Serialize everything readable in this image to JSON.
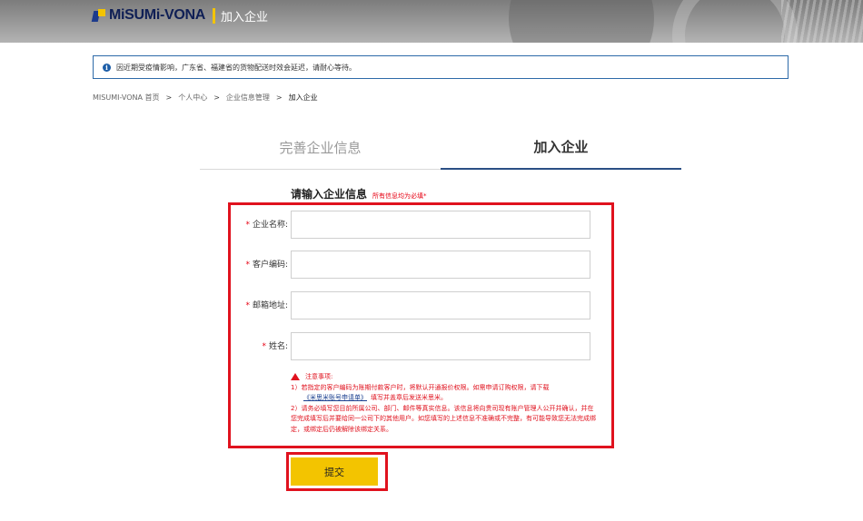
{
  "header": {
    "logo_text": "MiSUMi-VONA",
    "subtitle": "加入企业"
  },
  "notice": {
    "text": "因近期受疫情影响，广东省、福建省的货物配送时效会延迟，请耐心等待。"
  },
  "breadcrumb": {
    "items": [
      "MISUMI-VONA 首页",
      "个人中心",
      "企业信息管理",
      "加入企业"
    ],
    "separator": ">"
  },
  "tabs": [
    {
      "label": "完善企业信息",
      "active": false
    },
    {
      "label": "加入企业",
      "active": true
    }
  ],
  "form": {
    "title": "请输入企业信息",
    "required_hint": "所有信息均为必填*",
    "fields": [
      {
        "label": "企业名称:",
        "value": ""
      },
      {
        "label": "客户编码:",
        "value": ""
      },
      {
        "label": "邮箱地址:",
        "value": ""
      },
      {
        "label": "姓名:",
        "value": ""
      }
    ],
    "required_mark": "*"
  },
  "notes": {
    "heading": "注意事项:",
    "line1": "1）若指定的客户编码为账期付款客户时，将默认开通报价权限。如需申请订购权限，请下载",
    "link": "《米思米账号申请单》",
    "line1_tail": "填写并盖章后发送米思米。",
    "line2": "2）请务必填写您目前所属公司、部门、邮件等真实信息。该信息将向贵司现有账户管理人公开并确认，并在您完成填写后并要给同一公司下的其他用户。如您填写的上述信息不准确或不完整，有可能导致您无法完成绑定，或绑定后仍被解除该绑定关系。"
  },
  "submit": {
    "label": "提交"
  },
  "colors": {
    "accent_yellow": "#f3c400",
    "highlight_red": "#e0121e",
    "brand_navy": "#0f1f55",
    "tab_underline": "#2b4f85"
  }
}
